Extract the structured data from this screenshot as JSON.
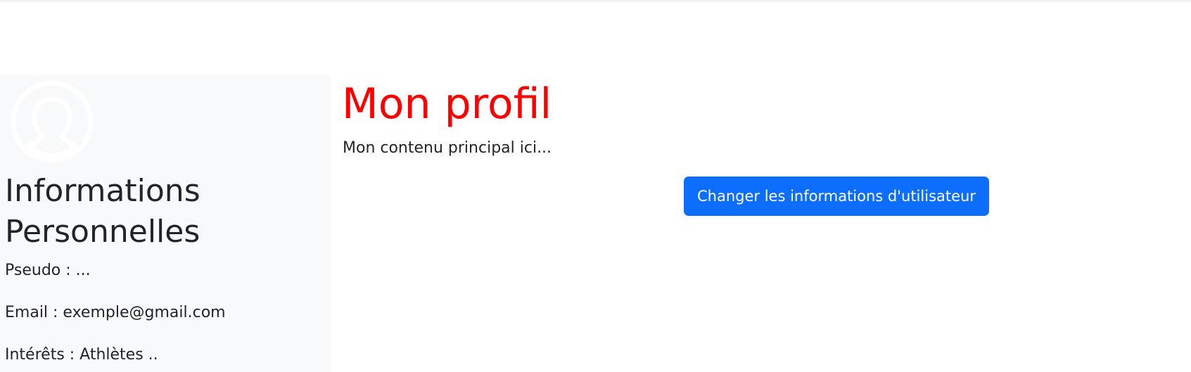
{
  "sidebar": {
    "avatar_icon": "user-circle-icon",
    "title": "Informations Personnelles",
    "pseudo": "Pseudo : ...",
    "email": "Email : exemple@gmail.com",
    "interests": "Intérêts : Athlètes .."
  },
  "main": {
    "title": "Mon profil",
    "text": "Mon contenu principal ici...",
    "button_label": "Changer les informations d'utilisateur"
  },
  "colors": {
    "title": "#ff0000",
    "button": "#0d6efd",
    "sidebar_bg": "#f8f9fa"
  }
}
